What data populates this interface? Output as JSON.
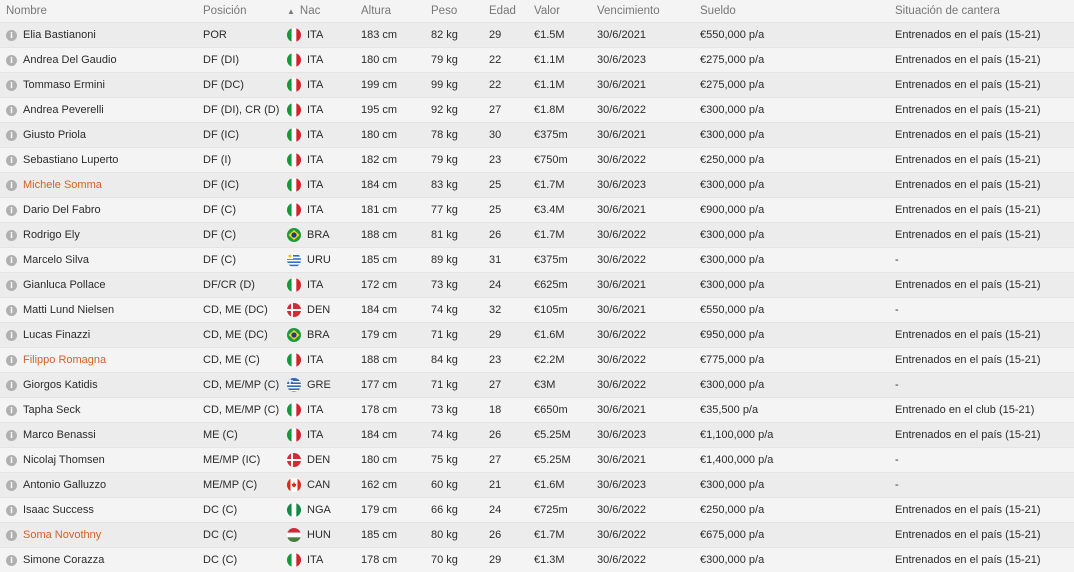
{
  "headers": {
    "nombre": "Nombre",
    "posicion": "Posición",
    "nac": "Nac",
    "altura": "Altura",
    "peso": "Peso",
    "edad": "Edad",
    "valor": "Valor",
    "vencimiento": "Vencimiento",
    "sueldo": "Sueldo",
    "cantera": "Situación de cantera"
  },
  "players": [
    {
      "name": "Elia Bastianoni",
      "pos": "POR",
      "flag": "ITA",
      "nat": "ITA",
      "height": "183 cm",
      "weight": "82 kg",
      "age": "29",
      "value": "€1.5M",
      "expiry": "30/6/2021",
      "wage": "€550,000 p/a",
      "hg": "Entrenados en el país (15-21)",
      "highlight": false
    },
    {
      "name": "Andrea Del Gaudio",
      "pos": "DF (DI)",
      "flag": "ITA",
      "nat": "ITA",
      "height": "180 cm",
      "weight": "79 kg",
      "age": "22",
      "value": "€1.1M",
      "expiry": "30/6/2023",
      "wage": "€275,000 p/a",
      "hg": "Entrenados en el país (15-21)",
      "highlight": false
    },
    {
      "name": "Tommaso Ermini",
      "pos": "DF (DC)",
      "flag": "ITA",
      "nat": "ITA",
      "height": "199 cm",
      "weight": "99 kg",
      "age": "22",
      "value": "€1.1M",
      "expiry": "30/6/2021",
      "wage": "€275,000 p/a",
      "hg": "Entrenados en el país (15-21)",
      "highlight": false
    },
    {
      "name": "Andrea Peverelli",
      "pos": "DF (DI), CR (D)",
      "flag": "ITA",
      "nat": "ITA",
      "height": "195 cm",
      "weight": "92 kg",
      "age": "27",
      "value": "€1.8M",
      "expiry": "30/6/2022",
      "wage": "€300,000 p/a",
      "hg": "Entrenados en el país (15-21)",
      "highlight": false
    },
    {
      "name": "Giusto Priola",
      "pos": "DF (IC)",
      "flag": "ITA",
      "nat": "ITA",
      "height": "180 cm",
      "weight": "78 kg",
      "age": "30",
      "value": "€375m",
      "expiry": "30/6/2021",
      "wage": "€300,000 p/a",
      "hg": "Entrenados en el país (15-21)",
      "highlight": false
    },
    {
      "name": "Sebastiano Luperto",
      "pos": "DF (I)",
      "flag": "ITA",
      "nat": "ITA",
      "height": "182 cm",
      "weight": "79 kg",
      "age": "23",
      "value": "€750m",
      "expiry": "30/6/2022",
      "wage": "€250,000 p/a",
      "hg": "Entrenados en el país (15-21)",
      "highlight": false
    },
    {
      "name": "Michele Somma",
      "pos": "DF (IC)",
      "flag": "ITA",
      "nat": "ITA",
      "height": "184 cm",
      "weight": "83 kg",
      "age": "25",
      "value": "€1.7M",
      "expiry": "30/6/2023",
      "wage": "€300,000 p/a",
      "hg": "Entrenados en el país (15-21)",
      "highlight": true
    },
    {
      "name": "Dario Del Fabro",
      "pos": "DF (C)",
      "flag": "ITA",
      "nat": "ITA",
      "height": "181 cm",
      "weight": "77 kg",
      "age": "25",
      "value": "€3.4M",
      "expiry": "30/6/2021",
      "wage": "€900,000 p/a",
      "hg": "Entrenados en el país (15-21)",
      "highlight": false
    },
    {
      "name": "Rodrigo Ely",
      "pos": "DF (C)",
      "flag": "BRA",
      "nat": "BRA",
      "height": "188 cm",
      "weight": "81 kg",
      "age": "26",
      "value": "€1.7M",
      "expiry": "30/6/2022",
      "wage": "€300,000 p/a",
      "hg": "Entrenados en el país (15-21)",
      "highlight": false
    },
    {
      "name": "Marcelo Silva",
      "pos": "DF (C)",
      "flag": "URU",
      "nat": "URU",
      "height": "185 cm",
      "weight": "89 kg",
      "age": "31",
      "value": "€375m",
      "expiry": "30/6/2022",
      "wage": "€300,000 p/a",
      "hg": "-",
      "highlight": false
    },
    {
      "name": "Gianluca Pollace",
      "pos": "DF/CR (D)",
      "flag": "ITA",
      "nat": "ITA",
      "height": "172 cm",
      "weight": "73 kg",
      "age": "24",
      "value": "€625m",
      "expiry": "30/6/2021",
      "wage": "€300,000 p/a",
      "hg": "Entrenados en el país (15-21)",
      "highlight": false
    },
    {
      "name": "Matti Lund Nielsen",
      "pos": "CD, ME (DC)",
      "flag": "DEN",
      "nat": "DEN",
      "height": "184 cm",
      "weight": "74 kg",
      "age": "32",
      "value": "€105m",
      "expiry": "30/6/2021",
      "wage": "€550,000 p/a",
      "hg": "-",
      "highlight": false
    },
    {
      "name": "Lucas Finazzi",
      "pos": "CD, ME (DC)",
      "flag": "BRA",
      "nat": "BRA",
      "height": "179 cm",
      "weight": "71 kg",
      "age": "29",
      "value": "€1.6M",
      "expiry": "30/6/2022",
      "wage": "€950,000 p/a",
      "hg": "Entrenados en el país (15-21)",
      "highlight": false
    },
    {
      "name": "Filippo Romagna",
      "pos": "CD, ME (C)",
      "flag": "ITA",
      "nat": "ITA",
      "height": "188 cm",
      "weight": "84 kg",
      "age": "23",
      "value": "€2.2M",
      "expiry": "30/6/2022",
      "wage": "€775,000 p/a",
      "hg": "Entrenados en el país (15-21)",
      "highlight": true
    },
    {
      "name": "Giorgos Katidis",
      "pos": "CD, ME/MP (C)",
      "flag": "GRE",
      "nat": "GRE",
      "height": "177 cm",
      "weight": "71 kg",
      "age": "27",
      "value": "€3M",
      "expiry": "30/6/2022",
      "wage": "€300,000 p/a",
      "hg": "-",
      "highlight": false
    },
    {
      "name": "Tapha Seck",
      "pos": "CD, ME/MP (C)",
      "flag": "ITA",
      "nat": "ITA",
      "height": "178 cm",
      "weight": "73 kg",
      "age": "18",
      "value": "€650m",
      "expiry": "30/6/2021",
      "wage": "€35,500 p/a",
      "hg": "Entrenado en el club (15-21)",
      "highlight": false
    },
    {
      "name": "Marco Benassi",
      "pos": "ME (C)",
      "flag": "ITA",
      "nat": "ITA",
      "height": "184 cm",
      "weight": "74 kg",
      "age": "26",
      "value": "€5.25M",
      "expiry": "30/6/2023",
      "wage": "€1,100,000 p/a",
      "hg": "Entrenados en el país (15-21)",
      "highlight": false
    },
    {
      "name": "Nicolaj Thomsen",
      "pos": "ME/MP (IC)",
      "flag": "DEN",
      "nat": "DEN",
      "height": "180 cm",
      "weight": "75 kg",
      "age": "27",
      "value": "€5.25M",
      "expiry": "30/6/2021",
      "wage": "€1,400,000 p/a",
      "hg": "-",
      "highlight": false
    },
    {
      "name": "Antonio Galluzzo",
      "pos": "ME/MP (C)",
      "flag": "CAN",
      "nat": "CAN",
      "height": "162 cm",
      "weight": "60 kg",
      "age": "21",
      "value": "€1.6M",
      "expiry": "30/6/2023",
      "wage": "€300,000 p/a",
      "hg": "-",
      "highlight": false
    },
    {
      "name": "Isaac Success",
      "pos": "DC (C)",
      "flag": "NGA",
      "nat": "NGA",
      "height": "179 cm",
      "weight": "66 kg",
      "age": "24",
      "value": "€725m",
      "expiry": "30/6/2022",
      "wage": "€250,000 p/a",
      "hg": "Entrenados en el país (15-21)",
      "highlight": false
    },
    {
      "name": "Soma Novothny",
      "pos": "DC (C)",
      "flag": "HUN",
      "nat": "HUN",
      "height": "185 cm",
      "weight": "80 kg",
      "age": "26",
      "value": "€1.7M",
      "expiry": "30/6/2022",
      "wage": "€675,000 p/a",
      "hg": "Entrenados en el país (15-21)",
      "highlight": true
    },
    {
      "name": "Simone Corazza",
      "pos": "DC (C)",
      "flag": "ITA",
      "nat": "ITA",
      "height": "178 cm",
      "weight": "70 kg",
      "age": "29",
      "value": "€1.3M",
      "expiry": "30/6/2022",
      "wage": "€300,000 p/a",
      "hg": "Entrenados en el país (15-21)",
      "highlight": false
    }
  ],
  "colors": {
    "highlight_name": "#d0622a",
    "text": "#2b2b2b",
    "header_text": "#777777"
  },
  "icons": {
    "info": "info-icon",
    "sort": "sort-ascending-icon"
  }
}
